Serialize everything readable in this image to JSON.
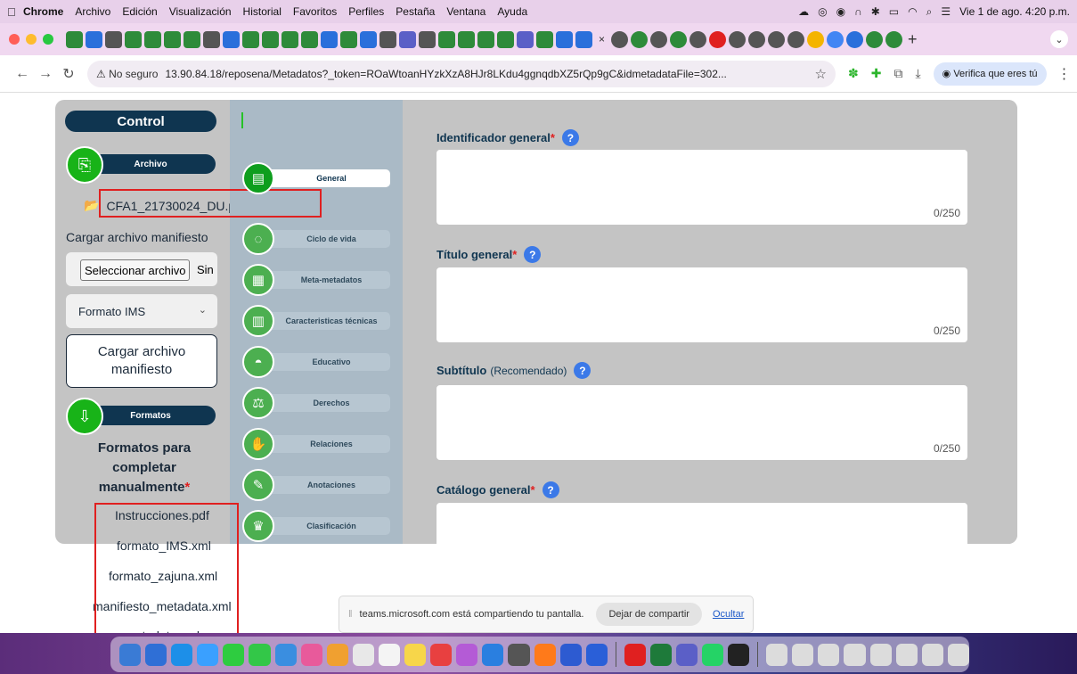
{
  "menubar": {
    "app_name": "Chrome",
    "items": [
      "Archivo",
      "Edición",
      "Visualización",
      "Historial",
      "Favoritos",
      "Perfiles",
      "Pestaña",
      "Ventana",
      "Ayuda"
    ],
    "clock": "Vie 1 de ago. 4:20 p.m."
  },
  "browser": {
    "security_label": "No seguro",
    "url": "13.90.84.18/reposena/Metadatos?_token=ROaWtoanHYzkXzA8HJr8LKdu4ggnqdbXZ5rQp9gC&idmetadataFile=302...",
    "profile_button": "Verifica que eres tú"
  },
  "left_panel": {
    "control_title": "Control",
    "archivo_label": "Archivo",
    "file_name": "CFA1_21730024_DU.p",
    "load_manifest_label": "Cargar archivo manifiesto",
    "select_file_button": "Seleccionar archivo",
    "no_file_text": "Sin",
    "format_select": "Formato IMS",
    "load_manifest_button_line1": "Cargar archivo",
    "load_manifest_button_line2": "manifiesto",
    "formatos_label": "Formatos",
    "formatos_title_line1": "Formatos para",
    "formatos_title_line2": "completar",
    "formatos_title_line3": "manualmente",
    "required_mark": "*",
    "files": [
      "Instrucciones.pdf",
      "formato_IMS.xml",
      "formato_zajuna.xml",
      "manifiesto_metadata.xml",
      "metadata.xml"
    ]
  },
  "nav": {
    "items": [
      "General",
      "Ciclo de vida",
      "Meta-metadatos",
      "Caracteristicas técnicas",
      "Educativo",
      "Derechos",
      "Relaciones",
      "Anotaciones",
      "Clasificación"
    ],
    "active": "General"
  },
  "form": {
    "fields": [
      {
        "label": "Identificador general",
        "required": "*",
        "note": "",
        "counter": "0/250"
      },
      {
        "label": "Título general",
        "required": "*",
        "note": "",
        "counter": "0/250"
      },
      {
        "label": "Subtítulo",
        "required": "",
        "note": "(Recomendado)",
        "counter": "0/250"
      },
      {
        "label": "Catálogo general",
        "required": "*",
        "note": "",
        "counter": ""
      }
    ],
    "help_glyph": "?"
  },
  "share_bar": {
    "message": "teams.microsoft.com está compartiendo tu pantalla.",
    "stop_button": "Dejar de compartir",
    "hide_link": "Ocultar"
  },
  "colors": {
    "accent_green": "#18b318",
    "navy": "#0f3550",
    "help_blue": "#3b79e8",
    "highlight_red": "#e02020"
  }
}
